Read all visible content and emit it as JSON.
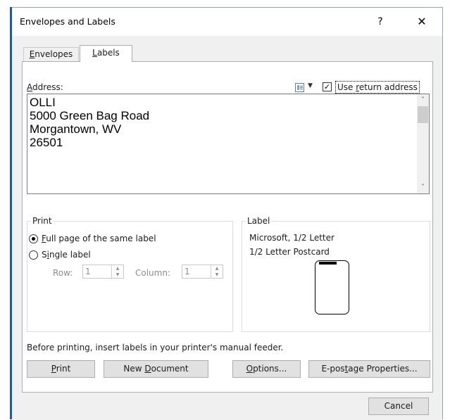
{
  "window": {
    "title": "Envelopes and Labels",
    "help_glyph": "?",
    "close_glyph": "✕"
  },
  "tabs": [
    {
      "label": "Envelopes",
      "mnemonic": "E",
      "rest": "nvelopes",
      "active": false
    },
    {
      "label": "Labels",
      "mnemonic": "L",
      "rest": "abels",
      "active": true
    }
  ],
  "address": {
    "label_mnemonic": "A",
    "label_rest": "ddress:",
    "lines": [
      "OLLI",
      "5000 Green Bag Road",
      "Morgantown, WV",
      "26501"
    ],
    "address_book_icon": "address-book-icon",
    "dropdown_glyph": "▼"
  },
  "use_return_address": {
    "checked": true,
    "check_glyph": "✓",
    "label_pre": "Use ",
    "label_mnemonic": "r",
    "label_post": "eturn address"
  },
  "print_group": {
    "title": "Print",
    "full_page": {
      "mnemonic": "F",
      "rest": "ull page of the same label",
      "selected": true
    },
    "single_label": {
      "pre": "S",
      "mnemonic": "i",
      "post": "ngle label",
      "selected": false
    },
    "row_label": "Row:",
    "row_value": "1",
    "column_label": "Column:",
    "column_value": "1"
  },
  "label_group": {
    "title": "Label",
    "vendor": "Microsoft, 1/2 Letter",
    "product": "1/2 Letter Postcard"
  },
  "note": "Before printing, insert labels in your printer's manual feeder.",
  "buttons": {
    "print": {
      "mnemonic": "P",
      "rest": "rint"
    },
    "new_document": {
      "pre": "New ",
      "mnemonic": "D",
      "post": "ocument"
    },
    "options": {
      "mnemonic": "O",
      "rest": "ptions..."
    },
    "epostage": {
      "pre": "E-pos",
      "mnemonic": "t",
      "post": "age Properties..."
    },
    "cancel": "Cancel"
  }
}
